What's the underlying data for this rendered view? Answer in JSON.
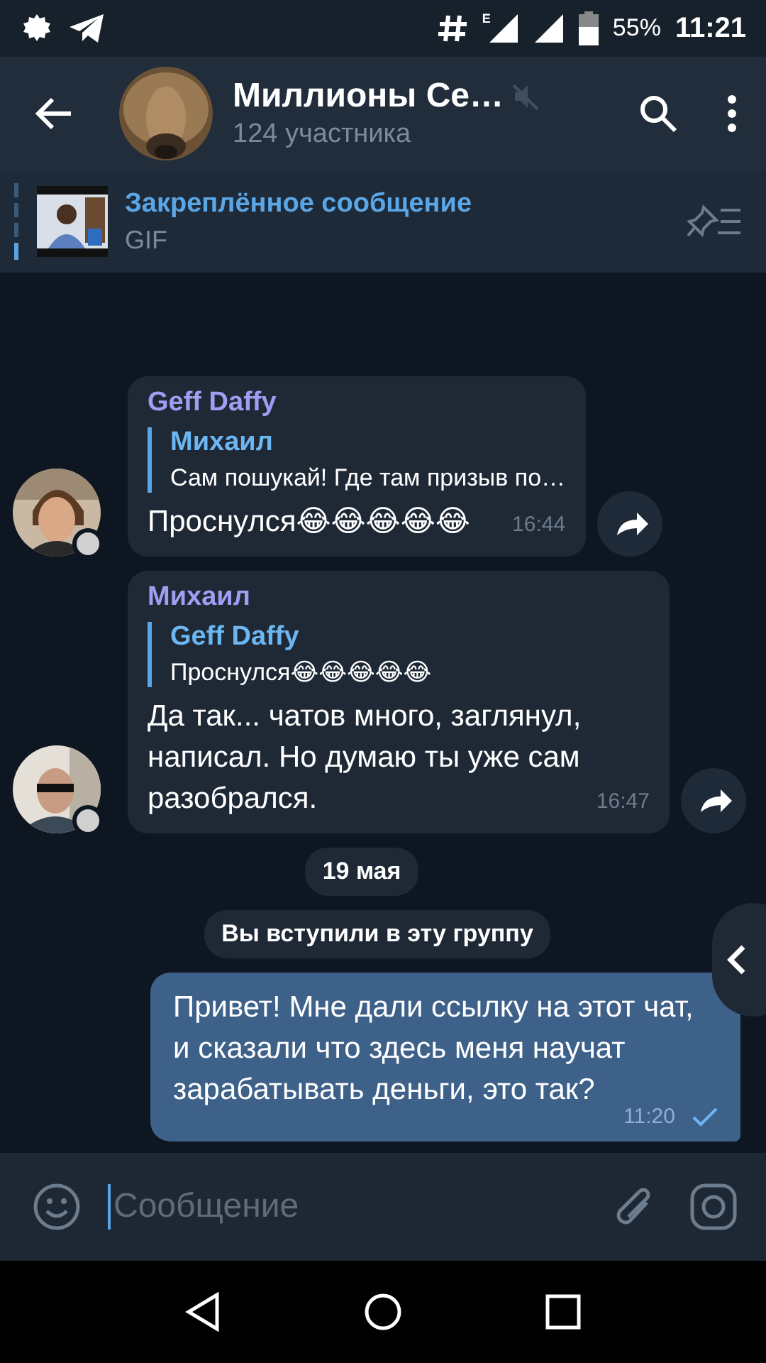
{
  "status_bar": {
    "network_type": "E",
    "battery": "55%",
    "time": "11:21"
  },
  "header": {
    "title": "Миллионы Се…",
    "subtitle": "124 участника",
    "muted": true
  },
  "pinned": {
    "title": "Закреплённое сообщение",
    "text": "GIF"
  },
  "messages": [
    {
      "kind": "incoming",
      "sender": "Geff Daffy",
      "reply_author": "Михаил",
      "reply_text": "Сам пошукай! Где там призыв по…",
      "text": "Проснулся😂😂😂😂😂",
      "time": "16:44"
    },
    {
      "kind": "incoming",
      "sender": "Михаил",
      "reply_author": "Geff Daffy",
      "reply_text": "Проснулся😂😂😂😂😂",
      "text": "Да так... чатов много, заглянул, написал. Но думаю ты уже сам разобрался.",
      "time": "16:47"
    },
    {
      "kind": "date",
      "text": "19 мая"
    },
    {
      "kind": "service",
      "text": "Вы вступили в эту группу"
    },
    {
      "kind": "outgoing",
      "text": "Привет! Мне дали ссылку на этот чат, и сказали что здесь меня научат зарабатывать деньги, это так?",
      "time": "11:20",
      "read": false
    }
  ],
  "composer": {
    "placeholder": "Сообщение"
  }
}
